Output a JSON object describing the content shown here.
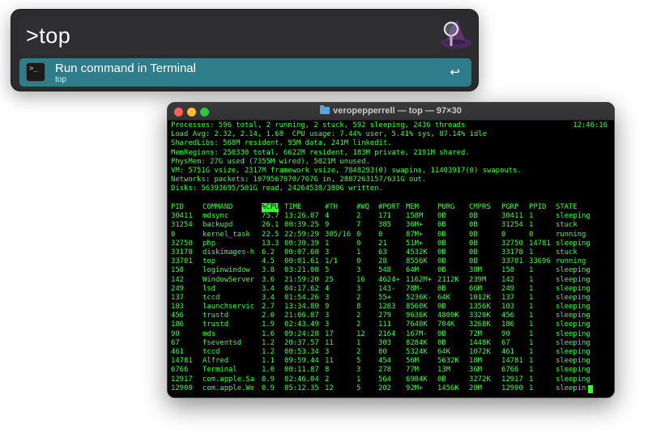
{
  "alfred": {
    "query": ">top",
    "result": {
      "title": "Run command in Terminal",
      "subtitle": "top",
      "enter_glyph": "↩",
      "icon_text": ">_"
    },
    "icons": {
      "hat": "alfred-hat-icon",
      "terminal": "terminal-icon"
    }
  },
  "terminal": {
    "title": "veropepperrell — top — 97×30",
    "time": "12:46:16",
    "header_lines": [
      "Processes: 596 total, 2 running, 2 stuck, 592 sleeping, 2436 threads",
      "Load Avg: 2.32, 2.14, 1.68  CPU usage: 7.44% user, 5.41% sys, 87.14% idle",
      "SharedLibs: 568M resident, 95M data, 241M linkedit.",
      "MemRegions: 250330 total, 6622M resident, 183M private, 2191M shared.",
      "PhysMem: 27G used (7355M wired), 5021M unused.",
      "VM: 5751G vsize, 2317M framework vsize, 7848293(0) swapins, 11403917(0) swapouts.",
      "Networks: packets: 1079567870/767G in, 2887263157/631G out.",
      "Disks: 56393695/501G read, 24264538/380G written."
    ],
    "columns": [
      "PID",
      "COMMAND",
      "%CPU",
      "TIME",
      "#TH",
      "#WQ",
      "#PORT",
      "MEM",
      "PURG",
      "CMPRS",
      "PGRP",
      "PPID",
      "STATE"
    ],
    "rows": [
      [
        "30411",
        "mdsync",
        "75.7",
        "13:26.07",
        "4",
        "2",
        "171",
        "158M",
        "0B",
        "0B",
        "30411",
        "1",
        "sleeping"
      ],
      [
        "31254",
        "backupd",
        "26.1",
        "00:39.25",
        "9",
        "7",
        "385",
        "36M+",
        "0B",
        "0B",
        "31254",
        "1",
        "stuck"
      ],
      [
        "0",
        "kernel_task",
        "22.5",
        "22:59:29",
        "305/16",
        "0",
        "0",
        "87M+",
        "0B",
        "0B",
        "0",
        "0",
        "running"
      ],
      [
        "32750",
        "php",
        "13.3",
        "00:30.39",
        "1",
        "0",
        "21",
        "51M+",
        "0B",
        "0B",
        "32750",
        "14781",
        "sleeping"
      ],
      [
        "33178",
        "diskimages-h",
        "6.2",
        "00:07.68",
        "3",
        "1",
        "63",
        "4532K",
        "0B",
        "0B",
        "33178",
        "1",
        "stuck"
      ],
      [
        "33701",
        "top",
        "4.5",
        "00:01.61",
        "1/1",
        "0",
        "28",
        "8556K",
        "0B",
        "0B",
        "33701",
        "33696",
        "running"
      ],
      [
        "158",
        "loginwindow",
        "3.8",
        "03:21.08",
        "5",
        "3",
        "548",
        "64M",
        "0B",
        "38M",
        "158",
        "1",
        "sleeping"
      ],
      [
        "142",
        "WindowServer",
        "3.6",
        "21:59:20",
        "25",
        "16",
        "4624+",
        "1162M+",
        "2112K",
        "239M",
        "142",
        "1",
        "sleeping"
      ],
      [
        "249",
        "lsd",
        "3.4",
        "04:17.62",
        "4",
        "3",
        "143-",
        "78M-",
        "0B",
        "66M",
        "249",
        "1",
        "sleeping"
      ],
      [
        "137",
        "tccd",
        "3.4",
        "01:54.26",
        "3",
        "2",
        "55+",
        "5236K-",
        "64K",
        "1012K",
        "137",
        "1",
        "sleeping"
      ],
      [
        "103",
        "launchservic",
        "2.7",
        "13:34.80",
        "9",
        "8",
        "1283",
        "8560K",
        "0B",
        "1356K",
        "103",
        "1",
        "sleeping"
      ],
      [
        "456",
        "trustd",
        "2.0",
        "21:06.87",
        "3",
        "2",
        "279",
        "9636K",
        "4800K",
        "3320K",
        "456",
        "1",
        "sleeping"
      ],
      [
        "186",
        "trustd",
        "1.9",
        "02:43.49",
        "3",
        "2",
        "111",
        "7640K",
        "704K",
        "3268K",
        "186",
        "1",
        "sleeping"
      ],
      [
        "90",
        "mds",
        "1.6",
        "09:24:28",
        "17",
        "12",
        "2164",
        "167M-",
        "0B",
        "72M",
        "90",
        "1",
        "sleeping"
      ],
      [
        "67",
        "fseventsd",
        "1.2",
        "20:37.57",
        "11",
        "1",
        "303",
        "8284K",
        "0B",
        "1448K",
        "67",
        "1",
        "sleeping"
      ],
      [
        "461",
        "tccd",
        "1.2",
        "00:53.34",
        "3",
        "2",
        "80",
        "5324K",
        "64K",
        "1072K",
        "461",
        "1",
        "sleeping"
      ],
      [
        "14781",
        "Alfred",
        "1.1",
        "09:59.44",
        "11",
        "5",
        "454",
        "56M",
        "5632K",
        "18M",
        "14781",
        "1",
        "sleeping"
      ],
      [
        "6766",
        "Terminal",
        "1.0",
        "00:11.87",
        "8",
        "3",
        "278",
        "77M",
        "13M",
        "36M",
        "6766",
        "1",
        "sleeping"
      ],
      [
        "12917",
        "com.apple.Sa",
        "0.9",
        "02:46.04",
        "2",
        "1",
        "564",
        "6984K",
        "0B",
        "3272K",
        "12917",
        "1",
        "sleeping"
      ],
      [
        "12900",
        "com.apple.We",
        "0.9",
        "05:12.35",
        "12",
        "5",
        "202",
        "92M+",
        "1456K",
        "20M",
        "12900",
        "1",
        "sleepin"
      ]
    ],
    "colors": {
      "text": "#33ff33",
      "background": "#000000"
    }
  }
}
